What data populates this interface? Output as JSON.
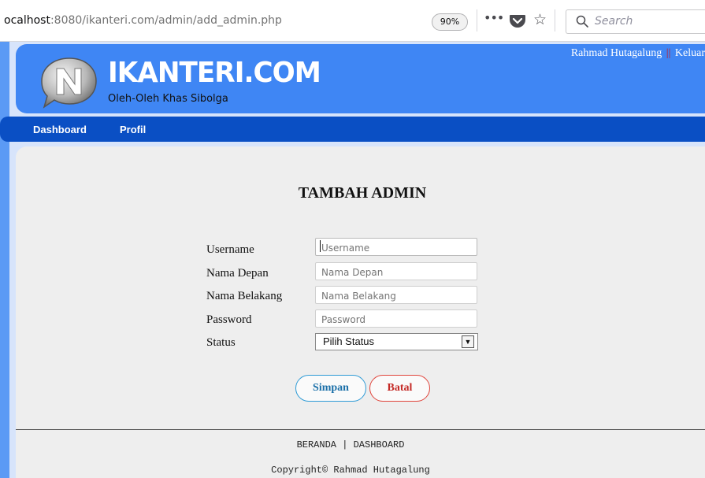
{
  "browser": {
    "url_prefix": "ocalhost",
    "url_rest": ":8080/ikanteri.com/admin/add_admin.php",
    "zoom": "90%",
    "more_label": "•••",
    "star_label": "☆",
    "search_placeholder": "Search"
  },
  "header": {
    "brand": "IKANTERI.COM",
    "tagline": "Oleh-Oleh Khas Sibolga",
    "user_name": "Rahmad Hutagalung",
    "separator": "||",
    "logout_label": "Keluar"
  },
  "nav": {
    "items": [
      {
        "label": "Dashboard"
      },
      {
        "label": "Profil"
      }
    ]
  },
  "form": {
    "title": "TAMBAH ADMIN",
    "fields": [
      {
        "label": "Username",
        "placeholder": "Username",
        "value": ""
      },
      {
        "label": "Nama Depan",
        "placeholder": "Nama Depan",
        "value": ""
      },
      {
        "label": "Nama Belakang",
        "placeholder": "Nama Belakang",
        "value": ""
      },
      {
        "label": "Password",
        "placeholder": "Password",
        "value": ""
      }
    ],
    "status": {
      "label": "Status",
      "selected": "Pilih Status"
    },
    "save_label": "Simpan",
    "cancel_label": "Batal"
  },
  "footer": {
    "link_home": "BERANDA",
    "link_separator": "|",
    "link_dashboard": "DASHBOARD",
    "copyright": "Copyright© Rahmad Hutagalung"
  },
  "colors": {
    "header_blue": "#3f86f4",
    "nav_blue": "#0a4fc4",
    "content_bg": "#eeeeee",
    "save_border": "#2e9bd6",
    "cancel_border": "#e0453c"
  }
}
